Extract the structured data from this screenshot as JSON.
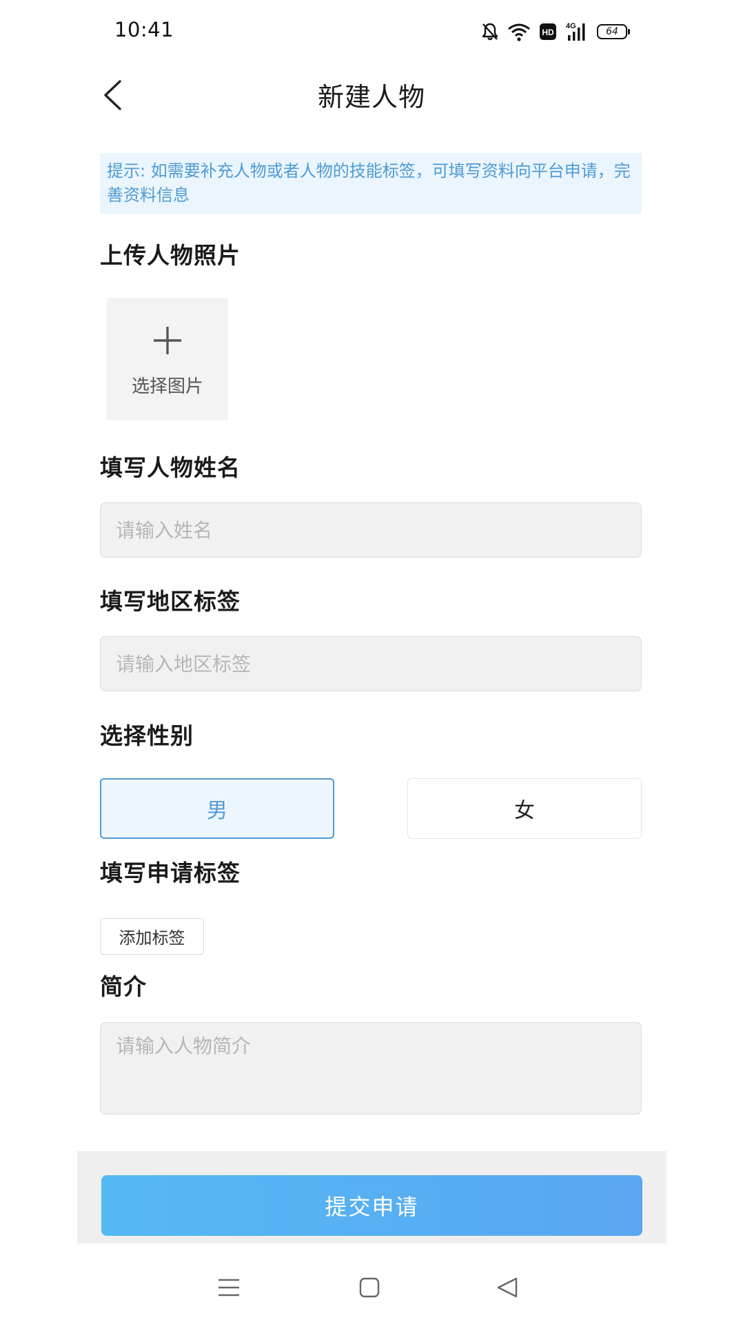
{
  "status_bar": {
    "time": "10:41",
    "battery": "64",
    "network": "4G",
    "hd_badge": "HD"
  },
  "nav": {
    "title": "新建人物"
  },
  "hint": {
    "text": "提示: 如需要补充人物或者人物的技能标签，可填写资料向平台申请，完善资料信息"
  },
  "photo": {
    "label": "上传人物照片",
    "button_label": "选择图片"
  },
  "name": {
    "label": "填写人物姓名",
    "placeholder": "请输入姓名",
    "value": ""
  },
  "region": {
    "label": "填写地区标签",
    "placeholder": "请输入地区标签",
    "value": ""
  },
  "gender": {
    "label": "选择性别",
    "options": [
      "男",
      "女"
    ],
    "selected": "男"
  },
  "tags": {
    "label": "填写申请标签",
    "add_button": "添加标签"
  },
  "intro": {
    "label": "简介",
    "placeholder": "请输入人物简介",
    "value": ""
  },
  "submit": {
    "label": "提交申请"
  },
  "colors": {
    "accent": "#4f9bd4",
    "hint_bg": "#eaf5fd",
    "submit_gradient_start": "#55b9f4",
    "submit_gradient_end": "#5aa6f0"
  }
}
